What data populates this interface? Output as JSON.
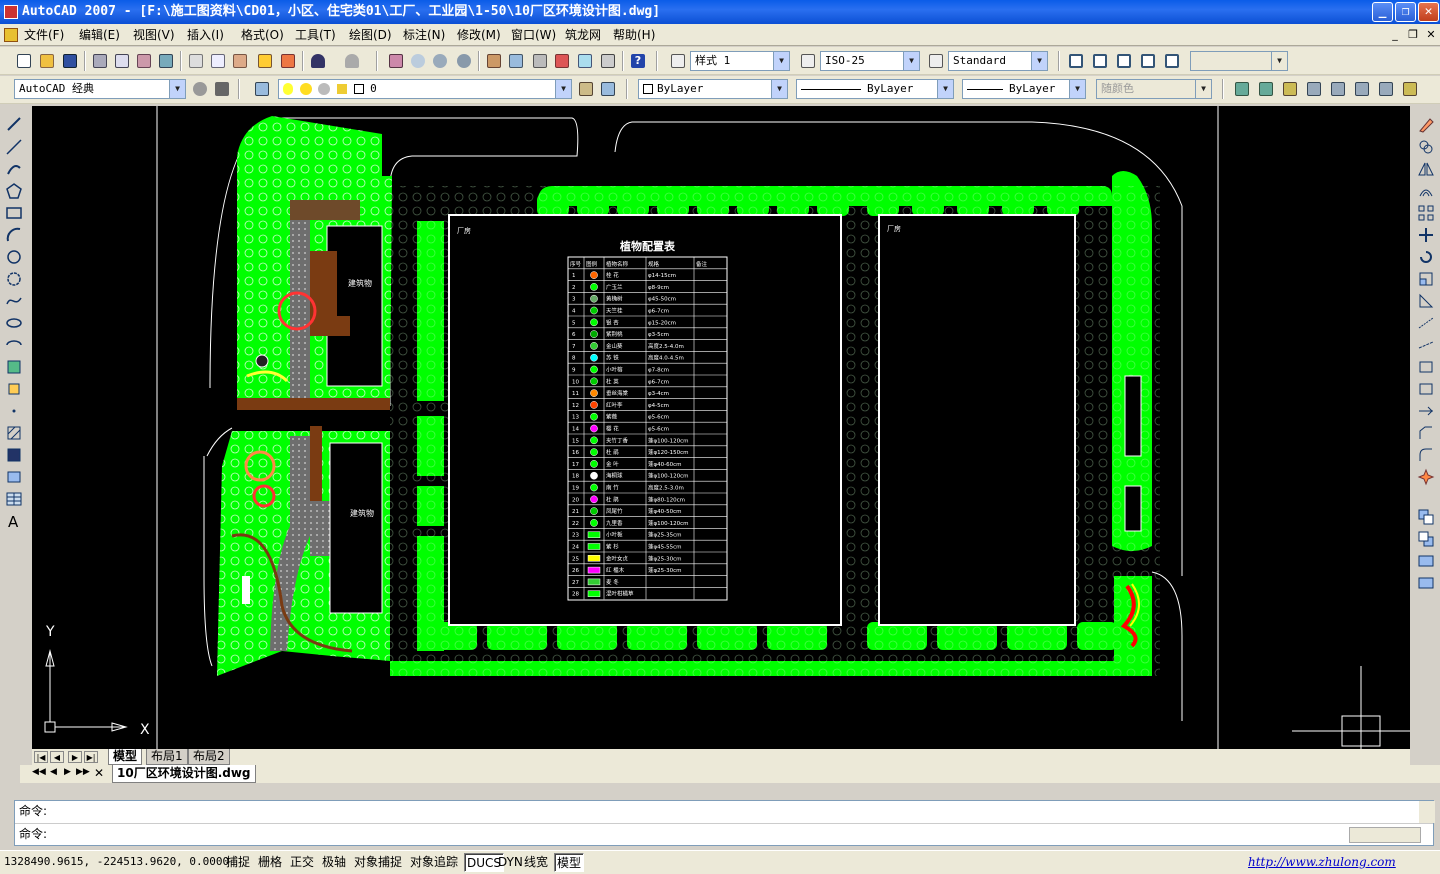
{
  "window": {
    "title": "AutoCAD 2007 - [F:\\施工图资料\\CD01，小区、住宅类01\\工厂、工业园\\1-50\\10厂区环境设计图.dwg]",
    "minimize": "_",
    "restore": "❐",
    "close": "✕"
  },
  "menu": {
    "items": [
      "文件(F)",
      "编辑(E)",
      "视图(V)",
      "插入(I)",
      "格式(O)",
      "工具(T)",
      "绘图(D)",
      "标注(N)",
      "修改(M)",
      "窗口(W)",
      "筑龙网",
      "帮助(H)"
    ],
    "mdi_min": "_",
    "mdi_restore": "❐",
    "mdi_close": "✕"
  },
  "toolbar1": {
    "text_style": "样式 1",
    "dim_style": "ISO-25",
    "table_style": "Standard"
  },
  "toolbar2": {
    "workspace": "AutoCAD 经典",
    "layer": "0",
    "color": "ByLayer",
    "linetype": "ByLayer",
    "lineweight": "ByLayer",
    "plotstyle": "随颜色"
  },
  "drawing": {
    "building_label_1": "建筑物",
    "building_label_2": "建筑物",
    "factory_label_1": "厂房",
    "factory_label_2": "厂房",
    "table_title": "植物配置表",
    "table_headers": [
      "序号",
      "图例",
      "植物名称",
      "规格",
      "备注"
    ],
    "table_rows": [
      {
        "no": "1",
        "name": "桂 花",
        "spec": "φ14-15cm"
      },
      {
        "no": "2",
        "name": "广玉兰",
        "spec": "φ8-9cm"
      },
      {
        "no": "3",
        "name": "黄桷树",
        "spec": "φ45-50cm"
      },
      {
        "no": "4",
        "name": "天竺桂",
        "spec": "φ6-7cm"
      },
      {
        "no": "5",
        "name": "银 杏",
        "spec": "φ15-20cm"
      },
      {
        "no": "6",
        "name": "紫荆桃",
        "spec": "φ3-5cm"
      },
      {
        "no": "7",
        "name": "金山葵",
        "spec": "高度2.5-4.0m"
      },
      {
        "no": "8",
        "name": "苏 铁",
        "spec": "高度4.0-4.5m"
      },
      {
        "no": "9",
        "name": "小叶榕",
        "spec": "φ7-8cm"
      },
      {
        "no": "10",
        "name": "杜 英",
        "spec": "φ6-7cm"
      },
      {
        "no": "11",
        "name": "垂丝海棠",
        "spec": "φ3-4cm"
      },
      {
        "no": "12",
        "name": "红叶李",
        "spec": "φ4-5cm"
      },
      {
        "no": "13",
        "name": "紫薇",
        "spec": "φ5-6cm"
      },
      {
        "no": "14",
        "name": "樱 花",
        "spec": "φ5-6cm"
      },
      {
        "no": "15",
        "name": "夹竹丁香",
        "spec": "蓬φ100-120cm"
      },
      {
        "no": "16",
        "name": "杜 鹃",
        "spec": "蓬φ120-150cm"
      },
      {
        "no": "17",
        "name": "金 叶",
        "spec": "蓬φ40-60cm"
      },
      {
        "no": "18",
        "name": "海桐球",
        "spec": "蓬φ100-120cm"
      },
      {
        "no": "19",
        "name": "南 竹",
        "spec": "高度2.5-3.0m"
      },
      {
        "no": "20",
        "name": "杜 鹃",
        "spec": "蓬φ80-120cm"
      },
      {
        "no": "21",
        "name": "凤尾竹",
        "spec": "蓬φ40-50cm"
      },
      {
        "no": "22",
        "name": "九里香",
        "spec": "蓬φ100-120cm"
      },
      {
        "no": "23",
        "name": "小叶栀",
        "spec": "蓬φ25-35cm"
      },
      {
        "no": "24",
        "name": "紫 杉",
        "spec": "蓬φ45-55cm"
      },
      {
        "no": "25",
        "name": "金叶女贞",
        "spec": "蓬φ25-30cm"
      },
      {
        "no": "26",
        "name": "红 檵木",
        "spec": "蓬φ25-30cm"
      },
      {
        "no": "27",
        "name": "麦 冬",
        "spec": ""
      },
      {
        "no": "28",
        "name": "混叶柑橘草",
        "spec": ""
      }
    ],
    "ucs_y": "Y",
    "ucs_x": "X"
  },
  "colors": {
    "lawn": "#00ff00",
    "paving": "#7a7a7a",
    "plaza": "#7a3b12",
    "lines": "#ffffff",
    "canvas": "#000000"
  },
  "layout_tabs": {
    "model": "模型",
    "layout1": "布局1",
    "layout2": "布局2"
  },
  "doc_tab": "10厂区环境设计图.dwg",
  "command": {
    "line1": "命令:",
    "line2": "命令:"
  },
  "status": {
    "coords": "1328490.9615, -224513.9620, 0.0000",
    "buttons": [
      "捕捉",
      "栅格",
      "正交",
      "极轴",
      "对象捕捉",
      "对象追踪",
      "DUCS",
      "DYN",
      "线宽",
      "模型"
    ],
    "link": "http://www.zhulong.com"
  }
}
